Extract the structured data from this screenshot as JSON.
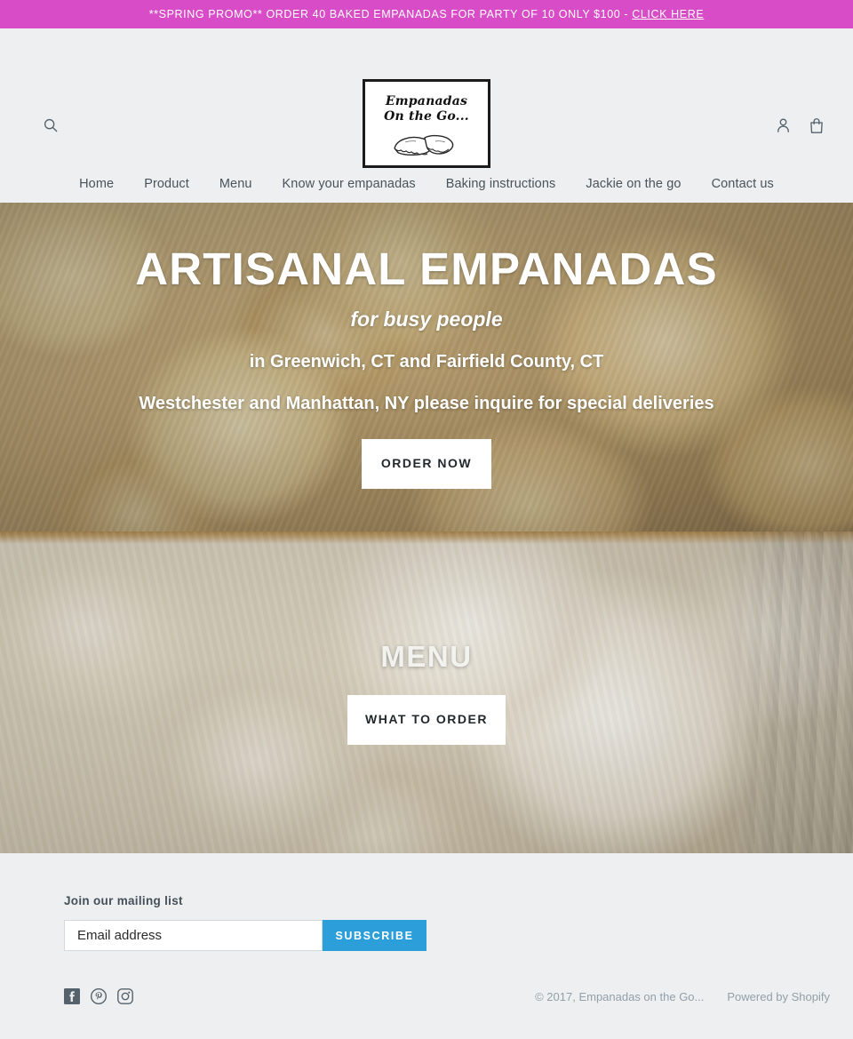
{
  "promo": {
    "text_plain": "**SPRING PROMO** ORDER 40 BAKED EMPANADAS FOR PARTY OF 10 ONLY  $100 - ",
    "text_link": "CLICK HERE",
    "bg_color": "#d94cc8",
    "text_color": "#ffffff"
  },
  "header": {
    "search_icon": "search-icon",
    "account_icon": "account-person-icon",
    "cart_icon": "shopping-bag-icon",
    "logo": {
      "line1": "Empanadas",
      "line2": "On the Go...",
      "art": "empanadas-illustration"
    }
  },
  "nav": {
    "items": [
      {
        "label": "Home"
      },
      {
        "label": "Product"
      },
      {
        "label": "Menu"
      },
      {
        "label": "Know your empanadas"
      },
      {
        "label": "Baking instructions"
      },
      {
        "label": "Jackie on the go"
      },
      {
        "label": "Contact us"
      }
    ]
  },
  "hero1": {
    "title": "ARTISANAL EMPANADAS",
    "subtitle": "for busy people",
    "line1": "in Greenwich, CT and Fairfield County, CT",
    "line2": "Westchester and Manhattan, NY please inquire for special deliveries",
    "button_label": "ORDER NOW",
    "image": "baked-empanadas-photo"
  },
  "hero2": {
    "title": "MENU",
    "button_label": "WHAT TO ORDER",
    "image": "raw-empanada-dough-photo"
  },
  "footer": {
    "newsletter": {
      "label": "Join our mailing list",
      "input_value": "",
      "input_placeholder": "Email address",
      "button_label": "SUBSCRIBE",
      "button_color": "#2c9fdb"
    },
    "social": [
      {
        "name": "facebook-icon"
      },
      {
        "name": "pinterest-icon"
      },
      {
        "name": "instagram-icon"
      }
    ],
    "copyright": "© 2017, Empanadas on the Go...",
    "powered_by": "Powered by Shopify"
  },
  "colors": {
    "page_bg": "#edeff0",
    "text": "#3d4246",
    "muted": "#93a0aa",
    "accent_promo": "#d94cc8",
    "accent_blue": "#2c9fdb"
  }
}
